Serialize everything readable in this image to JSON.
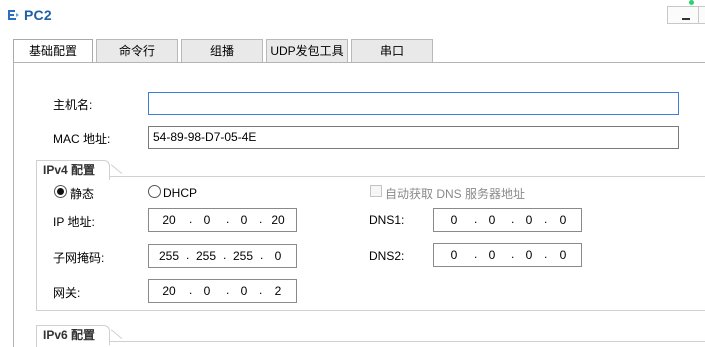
{
  "window": {
    "title": "PC2"
  },
  "tabs": [
    {
      "label": "基础配置",
      "active": true
    },
    {
      "label": "命令行",
      "active": false
    },
    {
      "label": "组播",
      "active": false
    },
    {
      "label": "UDP发包工具",
      "active": false
    },
    {
      "label": "串口",
      "active": false
    }
  ],
  "basic": {
    "hostname_label": "主机名:",
    "hostname_value": "",
    "mac_label": "MAC 地址:",
    "mac_value": "54-89-98-D7-05-4E"
  },
  "ipv4": {
    "section_title": "IPv4 配置",
    "static_label": "静态",
    "dhcp_label": "DHCP",
    "mode": "static",
    "auto_dns_label": "自动获取 DNS 服务器地址",
    "auto_dns_checked": false,
    "ip_label": "IP 地址:",
    "ip": [
      "20",
      "0",
      "0",
      "20"
    ],
    "mask_label": "子网掩码:",
    "mask": [
      "255",
      "255",
      "255",
      "0"
    ],
    "gateway_label": "网关:",
    "gateway": [
      "20",
      "0",
      "0",
      "2"
    ],
    "dns1_label": "DNS1:",
    "dns1": [
      "0",
      "0",
      "0",
      "0"
    ],
    "dns2_label": "DNS2:",
    "dns2": [
      "0",
      "0",
      "0",
      "0"
    ]
  },
  "ipv6": {
    "section_title": "IPv6 配置"
  },
  "colors": {
    "title_text": "#1f5fa8",
    "focus_border": "#3c7fd8",
    "panel_border": "#b4b4b4"
  }
}
